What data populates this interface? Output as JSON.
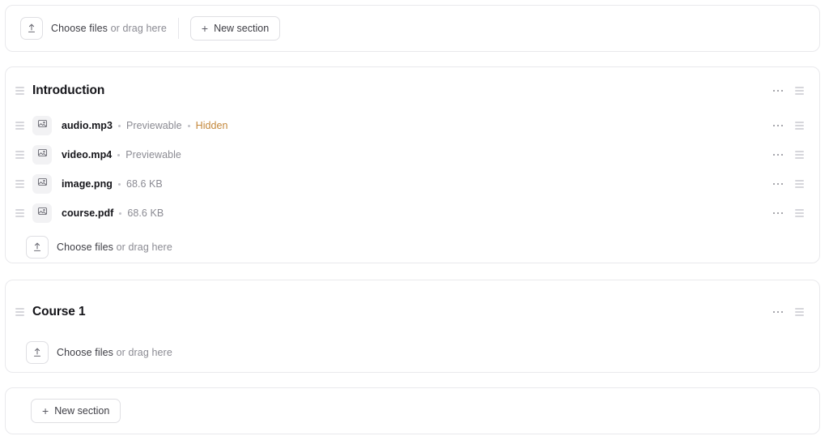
{
  "toolbar": {
    "upload": {
      "icon": "upload-icon",
      "label_strong": "Choose files",
      "label_muted": " or drag here"
    },
    "new_section_label": "New section",
    "new_section_plus": "+"
  },
  "colors": {
    "page_bg": "#ffffff",
    "card_border": "#e9e9ec",
    "text_primary": "#15151a",
    "text_muted": "#8b8b93",
    "hidden_badge": "#c4883b",
    "thumb_bg": "#f2f2f4"
  },
  "sections": [
    {
      "title": "Introduction",
      "handle_icon": "drag-handle-icon",
      "more_icon": "more-options-icon",
      "files": [
        {
          "name": "audio.mp3",
          "icon": "image-file-icon",
          "tags": [
            {
              "text": "Previewable",
              "style": "muted"
            },
            {
              "text": "Hidden",
              "style": "warning"
            }
          ]
        },
        {
          "name": "video.mp4",
          "icon": "image-file-icon",
          "tags": [
            {
              "text": "Previewable",
              "style": "muted"
            }
          ]
        },
        {
          "name": "image.png",
          "icon": "image-file-icon",
          "tags": [
            {
              "text": "68.6 KB",
              "style": "muted"
            }
          ]
        },
        {
          "name": "course.pdf",
          "icon": "image-file-icon",
          "tags": [
            {
              "text": "68.6 KB",
              "style": "muted"
            }
          ]
        }
      ],
      "upload": {
        "label_strong": "Choose files",
        "label_muted": " or drag here"
      }
    },
    {
      "title": "Course 1",
      "handle_icon": "drag-handle-icon",
      "more_icon": "more-options-icon",
      "files": [],
      "upload": {
        "label_strong": "Choose files",
        "label_muted": " or drag here"
      }
    }
  ],
  "footer": {
    "new_section_label": "New section",
    "new_section_plus": "+"
  }
}
